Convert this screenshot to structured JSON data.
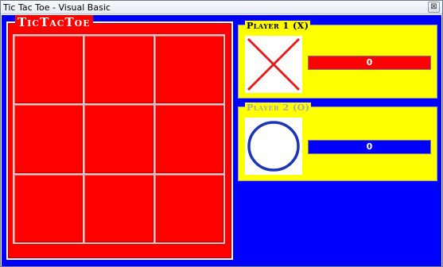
{
  "window": {
    "title": "Tic Tac Toe - Visual Basic",
    "close_glyph": "⊠"
  },
  "board": {
    "legend": "TicTacToe",
    "color": "#ff0000",
    "cells": [
      [
        "",
        "",
        ""
      ],
      [
        "",
        "",
        ""
      ],
      [
        "",
        "",
        ""
      ]
    ]
  },
  "players": [
    {
      "legend": "Player 1 (X)",
      "mark": "X",
      "icon": "x-mark-icon",
      "color": "#ff0000",
      "score": "0"
    },
    {
      "legend": "Player 2 (O)",
      "mark": "O",
      "icon": "o-mark-icon",
      "color": "#0000ff",
      "score": "0"
    }
  ],
  "colors": {
    "background": "#0000ff",
    "panel": "#ffff00",
    "x_mark": "#e02020",
    "o_mark": "#1c35b0"
  }
}
